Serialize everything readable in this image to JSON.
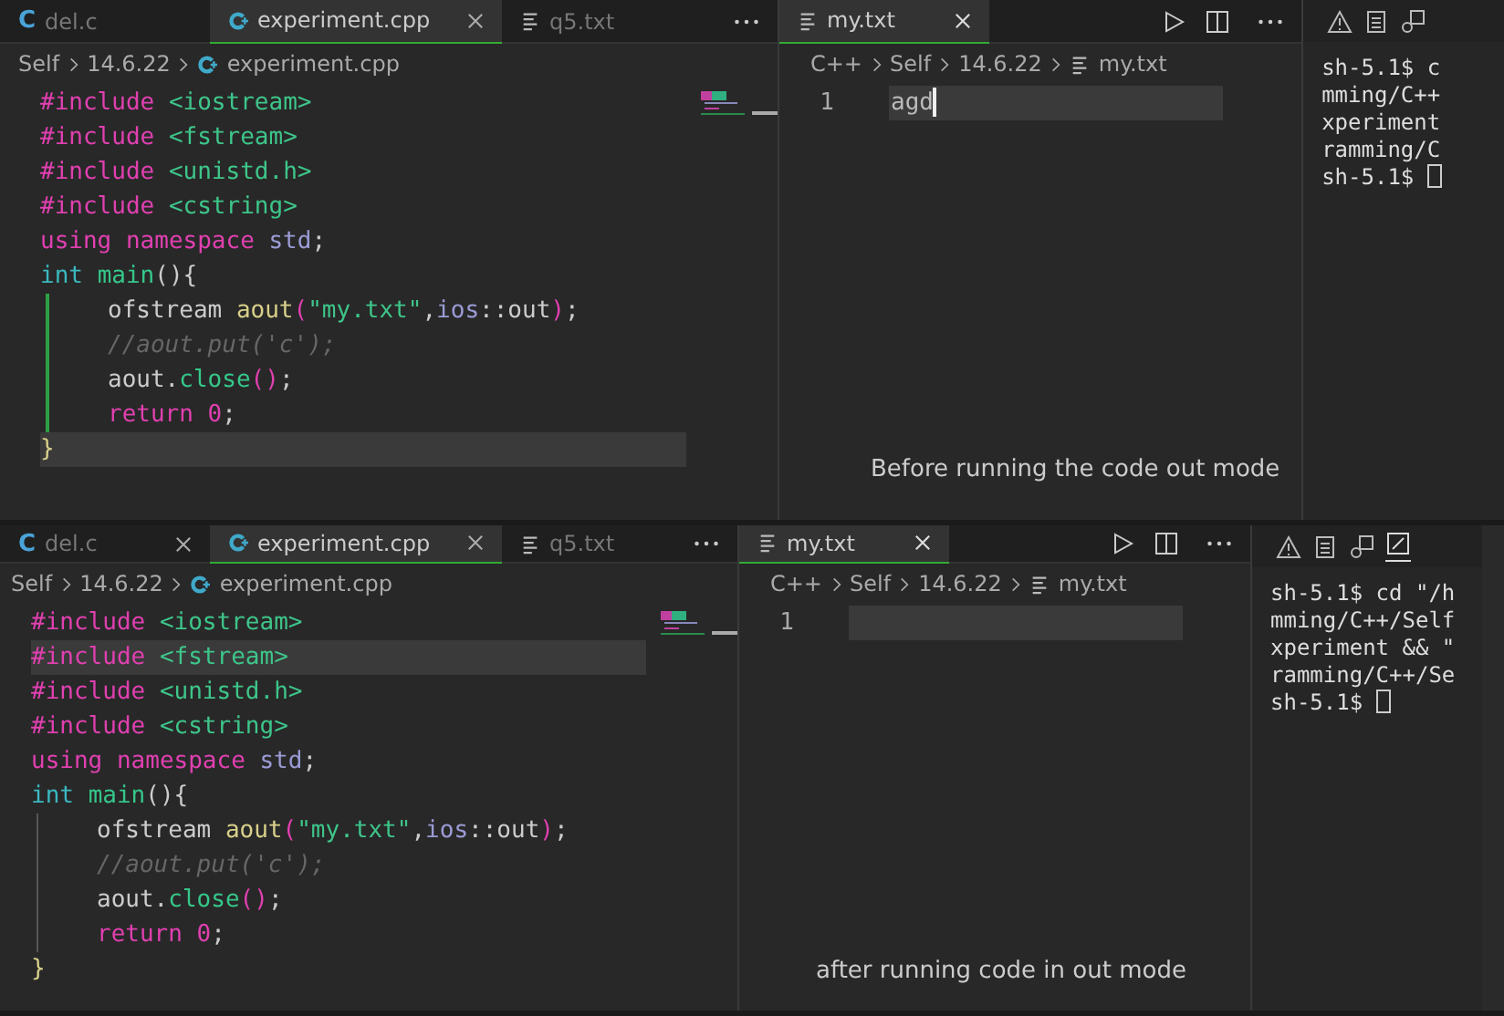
{
  "panels": [
    {
      "left_editor": {
        "tabs": [
          {
            "label": "del.c",
            "kind": "c",
            "glyph": "C",
            "selected": false,
            "closable": false
          },
          {
            "label": "experiment.cpp",
            "kind": "cpp",
            "selected": true,
            "closable": true
          },
          {
            "label": "q5.txt",
            "kind": "txt",
            "selected": false,
            "closable": false
          }
        ],
        "breadcrumb": [
          "Self",
          "14.6.22",
          "experiment.cpp"
        ],
        "changes_marked": true,
        "lines": [
          {
            "indent": false,
            "highlighted": false,
            "tokens": [
              {
                "t": "#include ",
                "kind": "kw"
              },
              {
                "t": "<iostream>",
                "kind": "str"
              }
            ]
          },
          {
            "indent": false,
            "highlighted": false,
            "tokens": [
              {
                "t": "#include ",
                "kind": "kw"
              },
              {
                "t": "<fstream>",
                "kind": "str"
              }
            ]
          },
          {
            "indent": false,
            "highlighted": false,
            "tokens": [
              {
                "t": "#include ",
                "kind": "kw"
              },
              {
                "t": "<unistd.h>",
                "kind": "str"
              }
            ]
          },
          {
            "indent": false,
            "highlighted": false,
            "tokens": [
              {
                "t": "#include ",
                "kind": "kw"
              },
              {
                "t": "<cstring>",
                "kind": "str"
              }
            ]
          },
          {
            "indent": false,
            "highlighted": false,
            "tokens": [
              {
                "t": "using namespace ",
                "kind": "kw"
              },
              {
                "t": "std",
                "kind": "var"
              },
              {
                "t": ";",
                "kind": "plain"
              }
            ]
          },
          {
            "indent": false,
            "highlighted": false,
            "tokens": [
              {
                "t": "int ",
                "kind": "type"
              },
              {
                "t": "main",
                "kind": "fn"
              },
              {
                "t": "(){",
                "kind": "plain"
              }
            ]
          },
          {
            "indent": true,
            "highlighted": false,
            "tokens": [
              {
                "t": "ofstream ",
                "kind": "plain"
              },
              {
                "t": "aout",
                "kind": "method"
              },
              {
                "t": "(",
                "kind": "kw"
              },
              {
                "t": "\"my.txt\"",
                "kind": "str"
              },
              {
                "t": ",",
                "kind": "plain"
              },
              {
                "t": "ios",
                "kind": "var"
              },
              {
                "t": "::out",
                "kind": "plain"
              },
              {
                "t": ")",
                "kind": "kw"
              },
              {
                "t": ";",
                "kind": "plain"
              }
            ]
          },
          {
            "indent": true,
            "highlighted": false,
            "tokens": [
              {
                "t": "//aout.put('c');",
                "kind": "comment"
              }
            ]
          },
          {
            "indent": true,
            "highlighted": false,
            "tokens": [
              {
                "t": "aout.",
                "kind": "plain"
              },
              {
                "t": "close",
                "kind": "fn"
              },
              {
                "t": "()",
                "kind": "kw"
              },
              {
                "t": ";",
                "kind": "plain"
              }
            ]
          },
          {
            "indent": true,
            "highlighted": false,
            "tokens": [
              {
                "t": "return ",
                "kind": "kw"
              },
              {
                "t": "0",
                "kind": "kw"
              },
              {
                "t": ";",
                "kind": "plain"
              }
            ]
          },
          {
            "indent": false,
            "highlighted": true,
            "tokens": [
              {
                "t": "}",
                "kind": "method"
              }
            ]
          }
        ]
      },
      "right_editor": {
        "tab": {
          "label": "my.txt",
          "selected": true
        },
        "breadcrumb": [
          "C++",
          "Self",
          "14.6.22",
          "my.txt"
        ],
        "lines": [
          {
            "number": "1",
            "text": "agd",
            "cursor": true
          }
        ],
        "caption": "Before running the code out mode"
      },
      "terminal": {
        "extra_icon": false,
        "lines": [
          {
            "text": "sh-5.1$ c",
            "cursor": false
          },
          {
            "text": "mming/C++",
            "cursor": false
          },
          {
            "text": "xperiment",
            "cursor": false
          },
          {
            "text": "ramming/C",
            "cursor": false
          },
          {
            "text": "sh-5.1$ ",
            "cursor": true
          }
        ]
      }
    },
    {
      "left_editor": {
        "tabs": [
          {
            "label": "del.c",
            "kind": "c",
            "glyph": "C",
            "selected": false,
            "closable": true
          },
          {
            "label": "experiment.cpp",
            "kind": "cpp",
            "selected": true,
            "closable": true
          },
          {
            "label": "q5.txt",
            "kind": "txt",
            "selected": false,
            "closable": false
          }
        ],
        "breadcrumb": [
          "Self",
          "14.6.22",
          "experiment.cpp"
        ],
        "changes_marked": false,
        "lines": [
          {
            "indent": false,
            "highlighted": false,
            "tokens": [
              {
                "t": "#include ",
                "kind": "kw"
              },
              {
                "t": "<iostream>",
                "kind": "str"
              }
            ]
          },
          {
            "indent": false,
            "highlighted": true,
            "tokens": [
              {
                "t": "#include ",
                "kind": "kw"
              },
              {
                "t": "<fstream>",
                "kind": "str"
              }
            ]
          },
          {
            "indent": false,
            "highlighted": false,
            "tokens": [
              {
                "t": "#include ",
                "kind": "kw"
              },
              {
                "t": "<unistd.h>",
                "kind": "str"
              }
            ]
          },
          {
            "indent": false,
            "highlighted": false,
            "tokens": [
              {
                "t": "#include ",
                "kind": "kw"
              },
              {
                "t": "<cstring>",
                "kind": "str"
              }
            ]
          },
          {
            "indent": false,
            "highlighted": false,
            "tokens": [
              {
                "t": "using namespace ",
                "kind": "kw"
              },
              {
                "t": "std",
                "kind": "var"
              },
              {
                "t": ";",
                "kind": "plain"
              }
            ]
          },
          {
            "indent": false,
            "highlighted": false,
            "tokens": [
              {
                "t": "int ",
                "kind": "type"
              },
              {
                "t": "main",
                "kind": "fn"
              },
              {
                "t": "(){",
                "kind": "plain"
              }
            ]
          },
          {
            "indent": true,
            "highlighted": false,
            "tokens": [
              {
                "t": "ofstream ",
                "kind": "plain"
              },
              {
                "t": "aout",
                "kind": "method"
              },
              {
                "t": "(",
                "kind": "kw"
              },
              {
                "t": "\"my.txt\"",
                "kind": "str"
              },
              {
                "t": ",",
                "kind": "plain"
              },
              {
                "t": "ios",
                "kind": "var"
              },
              {
                "t": "::out",
                "kind": "plain"
              },
              {
                "t": ")",
                "kind": "kw"
              },
              {
                "t": ";",
                "kind": "plain"
              }
            ]
          },
          {
            "indent": true,
            "highlighted": false,
            "tokens": [
              {
                "t": "//aout.put('c');",
                "kind": "comment"
              }
            ]
          },
          {
            "indent": true,
            "highlighted": false,
            "tokens": [
              {
                "t": "aout.",
                "kind": "plain"
              },
              {
                "t": "close",
                "kind": "fn"
              },
              {
                "t": "()",
                "kind": "kw"
              },
              {
                "t": ";",
                "kind": "plain"
              }
            ]
          },
          {
            "indent": true,
            "highlighted": false,
            "tokens": [
              {
                "t": "return ",
                "kind": "kw"
              },
              {
                "t": "0",
                "kind": "kw"
              },
              {
                "t": ";",
                "kind": "plain"
              }
            ]
          },
          {
            "indent": false,
            "highlighted": false,
            "tokens": [
              {
                "t": "}",
                "kind": "method"
              }
            ]
          }
        ]
      },
      "right_editor": {
        "tab": {
          "label": "my.txt",
          "selected": true
        },
        "breadcrumb": [
          "C++",
          "Self",
          "14.6.22",
          "my.txt"
        ],
        "lines": [
          {
            "number": "1",
            "cursor": false
          }
        ],
        "caption": "after running code in out mode"
      },
      "terminal": {
        "extra_icon": true,
        "lines": [
          {
            "text": "sh-5.1$ cd \"/h",
            "cursor": false
          },
          {
            "text": "mming/C++/Self",
            "cursor": false
          },
          {
            "text": "xperiment && \"",
            "cursor": false
          },
          {
            "text": "ramming/C++/Se",
            "cursor": false
          },
          {
            "text": "sh-5.1$ ",
            "cursor": true
          }
        ]
      }
    }
  ]
}
